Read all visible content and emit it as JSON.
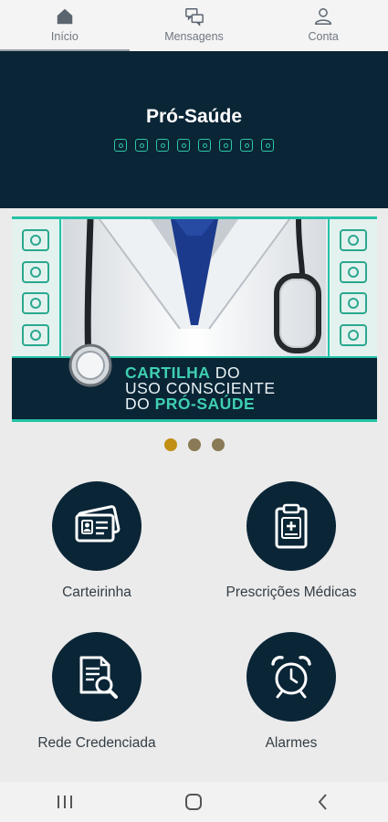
{
  "topnav": {
    "tabs": [
      {
        "label": "Início",
        "icon": "home-icon",
        "active": true
      },
      {
        "label": "Mensagens",
        "icon": "chat-icon",
        "active": false
      },
      {
        "label": "Conta",
        "icon": "user-icon",
        "active": false
      }
    ]
  },
  "header": {
    "brand": "Pró-Saúde"
  },
  "banner": {
    "line1_bold": "CARTILHA",
    "line1_rest": " DO",
    "line2": "USO CONSCIENTE",
    "line3_pre": "DO ",
    "line3_bold": "PRÓ-SAÚDE",
    "slide_count": 3,
    "active_slide": 1
  },
  "menu": {
    "items": [
      {
        "label": "Carteirinha",
        "icon": "id-card-icon"
      },
      {
        "label": "Prescrições Médicas",
        "icon": "clipboard-medical-icon"
      },
      {
        "label": "Rede Credenciada",
        "icon": "document-search-icon"
      },
      {
        "label": "Alarmes",
        "icon": "alarm-clock-icon"
      }
    ]
  },
  "colors": {
    "navy": "#0a2536",
    "teal": "#25c2a6",
    "dot_active": "#c08f14",
    "dot_inactive": "#8a7a55",
    "background": "#ebebeb"
  }
}
